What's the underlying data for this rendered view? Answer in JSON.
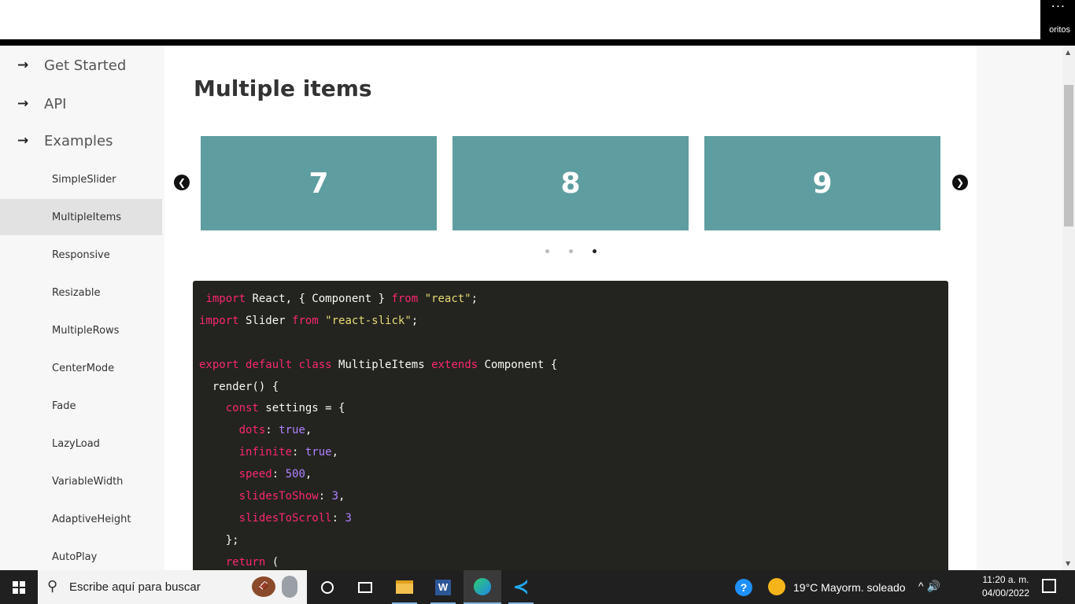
{
  "browser": {
    "menu_dots": "...",
    "favorites_fragment": "oritos"
  },
  "sidebar": {
    "top_items": [
      {
        "arrow": "→",
        "label": "Get Started"
      },
      {
        "arrow": "→",
        "label": "API"
      },
      {
        "arrow": "→",
        "label": "Examples"
      }
    ],
    "examples": [
      {
        "label": "SimpleSlider",
        "active": false
      },
      {
        "label": "MultipleItems",
        "active": true
      },
      {
        "label": "Responsive",
        "active": false
      },
      {
        "label": "Resizable",
        "active": false
      },
      {
        "label": "MultipleRows",
        "active": false
      },
      {
        "label": "CenterMode",
        "active": false
      },
      {
        "label": "Fade",
        "active": false
      },
      {
        "label": "LazyLoad",
        "active": false
      },
      {
        "label": "VariableWidth",
        "active": false
      },
      {
        "label": "AdaptiveHeight",
        "active": false
      },
      {
        "label": "AutoPlay",
        "active": false
      }
    ]
  },
  "main": {
    "title": "Multiple items",
    "slider": {
      "slides": [
        "7",
        "8",
        "9"
      ],
      "prev_arrow": "❮",
      "next_arrow": "❯",
      "dots_count": 3,
      "active_dot": 3,
      "slide_color": "#5f9ea0"
    },
    "code_lines": [
      " import React, { Component } from \"react\";",
      "import Slider from \"react-slick\";",
      "",
      "export default class MultipleItems extends Component {",
      "  render() {",
      "    const settings = {",
      "      dots: true,",
      "      infinite: true,",
      "      speed: 500,",
      "      slidesToShow: 3,",
      "      slidesToScroll: 3",
      "    };",
      "    return ("
    ]
  },
  "taskbar": {
    "search_placeholder": "Escribe aquí para buscar",
    "weather": "19°C  Mayorm. soleado",
    "tray": "^  🔊",
    "time": "11:20 a. m.",
    "date": "04/00/2022",
    "help_glyph": "?",
    "word_glyph": "W"
  }
}
